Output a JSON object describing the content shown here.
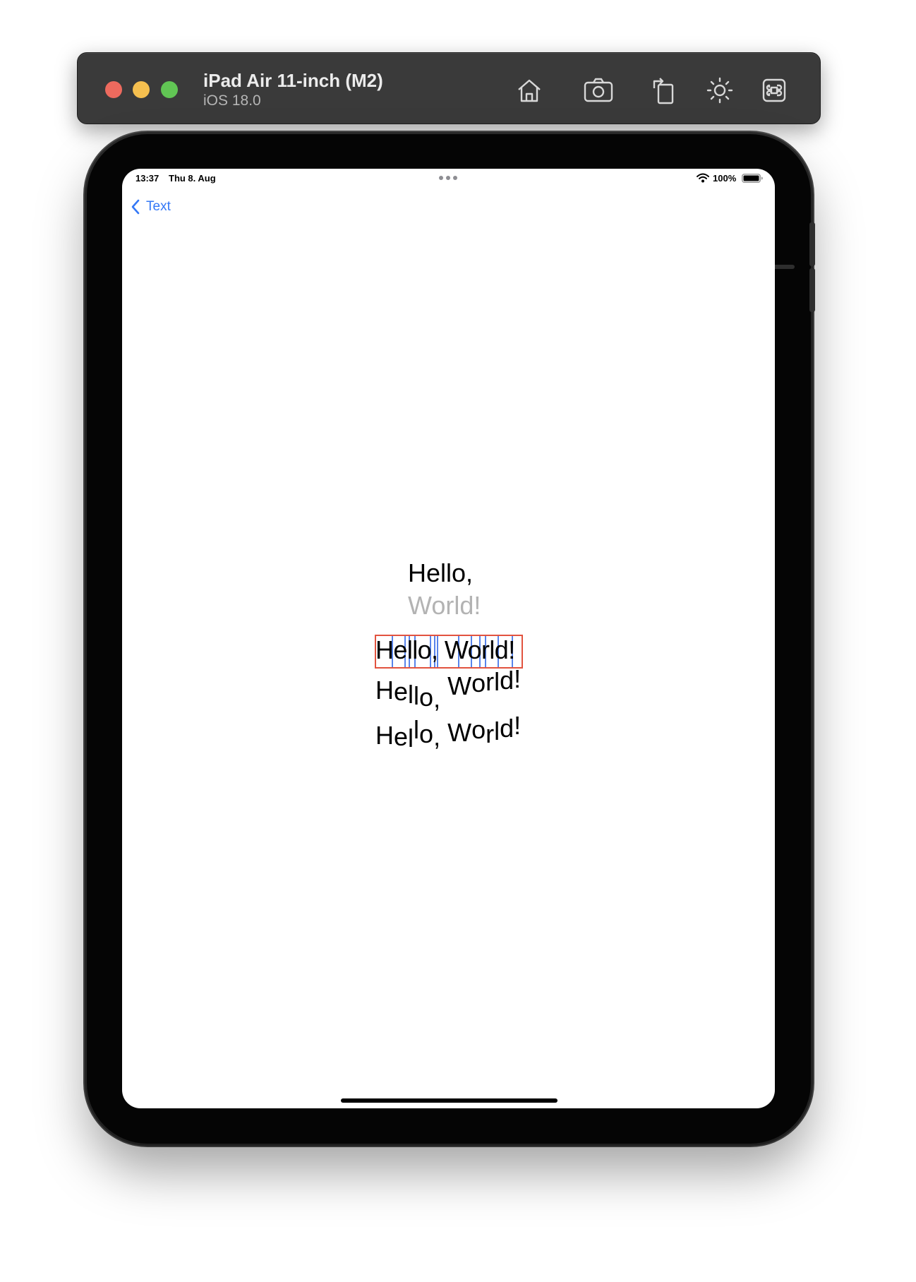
{
  "simulator": {
    "device_name": "iPad Air 11-inch (M2)",
    "os_version": "iOS 18.0",
    "toolbar_icons": [
      "home-icon",
      "screenshot-icon",
      "rotate-icon",
      "appearance-icon",
      "command-icon"
    ]
  },
  "status_bar": {
    "time": "13:37",
    "date": "Thu 8. Aug",
    "battery": "100%"
  },
  "nav": {
    "back_label": "Text"
  },
  "content": {
    "line1": "Hello,",
    "line2": "World!",
    "line3": "Hello, World!",
    "wave1": [
      "H",
      "e",
      "l",
      "l",
      "o",
      ",",
      " ",
      "W",
      "o",
      "r",
      "l",
      "d",
      "!"
    ],
    "wave2": [
      "H",
      "e",
      "l",
      "l",
      "o",
      ",",
      " ",
      "W",
      "o",
      "r",
      "l",
      "d",
      "!"
    ]
  },
  "colors": {
    "accent": "#3478f6",
    "secondary_text": "#b3b3b3",
    "debug_border": "#e2533f",
    "debug_glyph": "#3b6fe8"
  }
}
